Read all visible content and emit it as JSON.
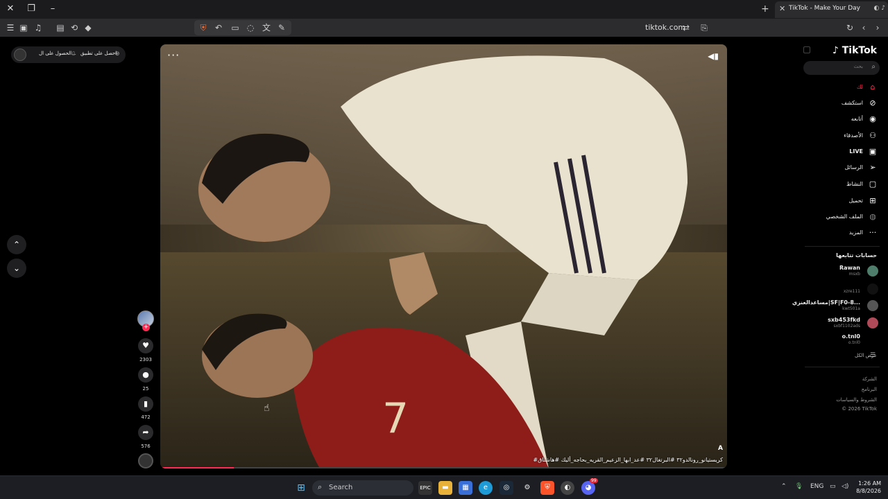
{
  "browser": {
    "tab_title": "TikTok - Make Your Day",
    "url": "tiktok.com"
  },
  "top_pill": {
    "get_app": "احصل على تطبيق",
    "get_coins": "الحصول على ال..."
  },
  "video": {
    "caption": "#كريستيانو_رونالدو٣٢ #البرتغال٣٢ #عد_ابها_الزعيم_القريه_بحاجه_أليك #هاشتاق",
    "corner_mark": "A",
    "progress_fraction": 0.13
  },
  "actions": {
    "likes": "2303",
    "comments": "25",
    "saves": "472",
    "shares": "576"
  },
  "sidebar": {
    "logo": "TikTok",
    "search_placeholder": "بحث",
    "nav": [
      {
        "label": "لك",
        "icon": "home-icon"
      },
      {
        "label": "استكشف",
        "icon": "compass-icon"
      },
      {
        "label": "أتابعه",
        "icon": "following-icon"
      },
      {
        "label": "الأصدقاء",
        "icon": "friends-icon"
      },
      {
        "label": "LIVE",
        "icon": "live-icon"
      },
      {
        "label": "الرسائل",
        "icon": "messages-icon"
      },
      {
        "label": "النشاط",
        "icon": "activity-icon"
      },
      {
        "label": "تحميل",
        "icon": "upload-icon"
      },
      {
        "label": "الملف الشخصي",
        "icon": "profile-icon"
      },
      {
        "label": "المزيد",
        "icon": "more-icon"
      }
    ],
    "following_title": "حسابات تتابعها",
    "accounts": [
      {
        "name": "Rawan",
        "user": "msxb"
      },
      {
        "name": "",
        "user": "xzre111"
      },
      {
        "name": "مساعدالعنزي|SF|F0-8...",
        "user": "kwt501a"
      },
      {
        "name": "sxb453fkd",
        "user": "sxbf1102ads"
      },
      {
        "name": "o.tnl0",
        "user": "o.tnl0"
      }
    ],
    "see_all": "عرض الكل",
    "footer": [
      "الشركة",
      "البرنامج",
      "الشروط والسياسات",
      "© 2026 TikTok"
    ]
  },
  "taskbar": {
    "search": "Search",
    "lang": "ENG",
    "time": "1:26 AM",
    "date": "8/8/2026",
    "badge": "99"
  }
}
